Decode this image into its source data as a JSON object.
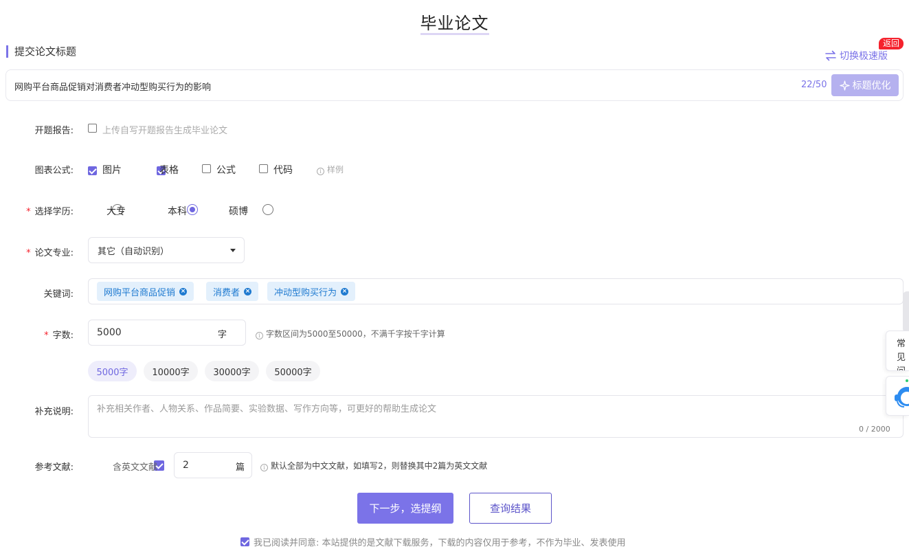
{
  "page": {
    "title": "毕业论文"
  },
  "section": {
    "title": "提交论文标题"
  },
  "switch": {
    "label": "切换极速版"
  },
  "badge": {
    "back": "返回"
  },
  "title_input": {
    "value": "网购平台商品促销对消费者冲动型购买行为的影响",
    "count": "22/50",
    "optimize_label": "标题优化"
  },
  "proposal": {
    "label": "开题报告:",
    "option": "上传自写开题报告生成毕业论文"
  },
  "figures": {
    "label": "图表公式:",
    "options": [
      {
        "label": "图片",
        "checked": true
      },
      {
        "label": "表格",
        "checked": true
      },
      {
        "label": "公式",
        "checked": false
      },
      {
        "label": "代码",
        "checked": false
      }
    ],
    "sample": "样例"
  },
  "degree": {
    "label": "选择学历:",
    "options": [
      {
        "label": "大专",
        "selected": false
      },
      {
        "label": "本科",
        "selected": true
      },
      {
        "label": "硕博",
        "selected": false
      }
    ]
  },
  "major": {
    "label": "论文专业:",
    "value": "其它（自动识别）"
  },
  "keywords": {
    "label": "关键词:",
    "tags": [
      "网购平台商品促销",
      "消费者",
      "冲动型购买行为"
    ]
  },
  "words": {
    "label": "字数:",
    "value": "5000",
    "unit": "字",
    "hint": "字数区间为5000至50000，不满千字按千字计算",
    "presets": [
      "5000字",
      "10000字",
      "30000字",
      "50000字"
    ]
  },
  "supplement": {
    "label": "补充说明:",
    "placeholder": "补充相关作者、人物关系、作品简要、实验数据、写作方向等，可更好的帮助生成论文",
    "count": "0 / 2000"
  },
  "references": {
    "label": "参考文献:",
    "option": "含英文文献",
    "value": "2",
    "unit": "篇",
    "hint": "默认全部为中文文献，如填写2，则替换其中2篇为英文文献"
  },
  "actions": {
    "next": "下一步，选提纲",
    "query": "查询结果"
  },
  "agree": {
    "text": "我已阅读并同意: 本站提供的是文献下载服务，下载的内容仅用于参考，不作为毕业、发表使用"
  },
  "side": {
    "faq_line1": "常见",
    "faq_line2": "问题"
  },
  "colors": {
    "accent": "#7b73e8",
    "badge": "#f5222d",
    "tag_bg": "#e3f0fc",
    "tag_text": "#1f7ad0"
  }
}
